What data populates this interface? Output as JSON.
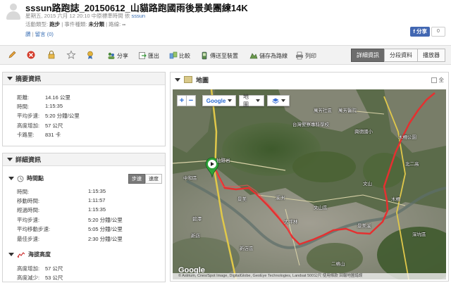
{
  "header": {
    "title": "sssun路跑誌_20150612_山貓路跑國雨後景美團練14K",
    "meta_date": "星期五, 2015 六月 12 20:10 中原標準時間 依",
    "user": "sssun",
    "activity_type_label": "活動類型:",
    "activity_type": "跑步",
    "event_type_label": "| 事件種類:",
    "event_type": "未分類",
    "device_label": "| 路線:",
    "device": "--",
    "like_link": "讚",
    "comment_link": "留言 (0)",
    "fb_share": "分享",
    "fb_count": "0"
  },
  "toolbar": {
    "items": [
      {
        "label": "分享",
        "icon": "share-icon"
      },
      {
        "label": "匯出",
        "icon": "export-icon"
      },
      {
        "label": "比較",
        "icon": "compare-icon"
      },
      {
        "label": "傳送至裝置",
        "icon": "send-device-icon"
      },
      {
        "label": "儲存為路線",
        "icon": "save-course-icon"
      },
      {
        "label": "列印",
        "icon": "print-icon"
      }
    ],
    "tabs": [
      "詳細資訊",
      "分段資料",
      "播放器"
    ]
  },
  "summary": {
    "title": "摘要資訊",
    "rows": [
      {
        "label": "距離:",
        "value": "14.16 公里"
      },
      {
        "label": "時間:",
        "value": "1:15:35"
      },
      {
        "label": "平均步速:",
        "value": "5:20 分鐘/公里"
      },
      {
        "label": "高度增加:",
        "value": "57 公尺"
      },
      {
        "label": "卡路里:",
        "value": "831 卡"
      }
    ]
  },
  "details": {
    "title": "詳細資訊",
    "time_section": {
      "title": "時間點",
      "toggle": [
        "步速",
        "速度"
      ],
      "rows": [
        {
          "label": "時間:",
          "value": "1:15:35"
        },
        {
          "label": "移動時間:",
          "value": "1:11:57"
        },
        {
          "label": "經過時間:",
          "value": "1:15:35"
        },
        {
          "label": "平均步速:",
          "value": "5:20 分鐘/公里"
        },
        {
          "label": "平均移動步速:",
          "value": "5:05 分鐘/公里"
        },
        {
          "label": "最佳步速:",
          "value": "2:30 分鐘/公里"
        }
      ]
    },
    "elevation_section": {
      "title": "海拔高度",
      "rows": [
        {
          "label": "高度增加:",
          "value": "57 公尺"
        },
        {
          "label": "高度減少:",
          "value": "53 公尺"
        }
      ]
    }
  },
  "map": {
    "title": "地圖",
    "fullscreen": "全",
    "provider": "Google",
    "map_type": "地圖",
    "zoom_in": "+",
    "zoom_out": "−",
    "google_logo": "Google",
    "attribution": "© Astrium, Cnes/Spot Image, DigitalGlobe, GeoEye Technologies, Landsat  500公尺  使用條款  回報地圖錯誤",
    "labels": [
      {
        "text": "台灣警察專科學校"
      },
      {
        "text": "萬芳社區"
      },
      {
        "text": "興德國小"
      },
      {
        "text": "萬芳醫院"
      },
      {
        "text": "木柵公園"
      },
      {
        "text": "景美"
      },
      {
        "text": "仙跡岩"
      },
      {
        "text": "溪洲"
      },
      {
        "text": "大坪林"
      },
      {
        "text": "新店區"
      },
      {
        "text": "文山區"
      },
      {
        "text": "木柵"
      },
      {
        "text": "二格山"
      },
      {
        "text": "碧潭"
      },
      {
        "text": "新店"
      },
      {
        "text": "深坑區"
      },
      {
        "text": "景美溪"
      },
      {
        "text": "中和區"
      },
      {
        "text": "文山"
      },
      {
        "text": "北二高"
      }
    ]
  }
}
